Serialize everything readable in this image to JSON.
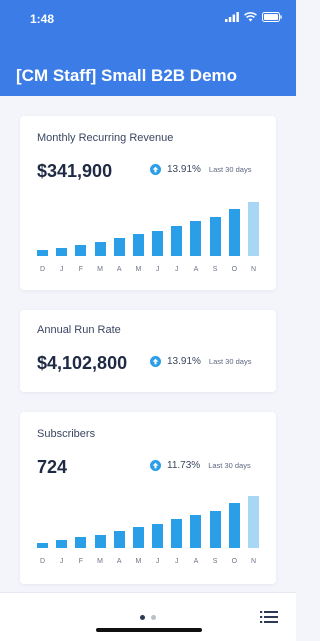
{
  "status_bar": {
    "time": "1:48"
  },
  "header": {
    "title": "[CM Staff] Small B2B Demo",
    "accent": "#3b7ce6"
  },
  "cards": [
    {
      "title": "Monthly Recurring Revenue",
      "value": "$341,900",
      "change_pct": "13.91%",
      "change_period": "Last 30 days"
    },
    {
      "title": "Annual Run Rate",
      "value": "$4,102,800",
      "change_pct": "13.91%",
      "change_period": "Last 30 days"
    },
    {
      "title": "Subscribers",
      "value": "724",
      "change_pct": "11.73%",
      "change_period": "Last 30 days"
    }
  ],
  "chart_data": [
    {
      "type": "bar",
      "categories": [
        "D",
        "J",
        "F",
        "M",
        "A",
        "M",
        "J",
        "J",
        "A",
        "S",
        "O",
        "N"
      ],
      "values": [
        2,
        3,
        4,
        5,
        6.5,
        8,
        9,
        11,
        12.5,
        14,
        17,
        19.5
      ],
      "bar_color": "#2a9fe8",
      "current_bar_color": "#a7d7f5"
    },
    {
      "type": "bar",
      "categories": [
        "D",
        "J",
        "F",
        "M",
        "A",
        "M",
        "J",
        "J",
        "A",
        "S",
        "O",
        "N"
      ],
      "values": [
        2,
        3,
        4,
        5,
        6.5,
        8,
        9,
        11,
        12.5,
        14,
        17,
        19.5
      ],
      "bar_color": "#2a9fe8",
      "current_bar_color": "#a7d7f5"
    }
  ],
  "icons": {
    "change": "arrow-up-circle-icon",
    "menu": "list-menu-icon"
  }
}
